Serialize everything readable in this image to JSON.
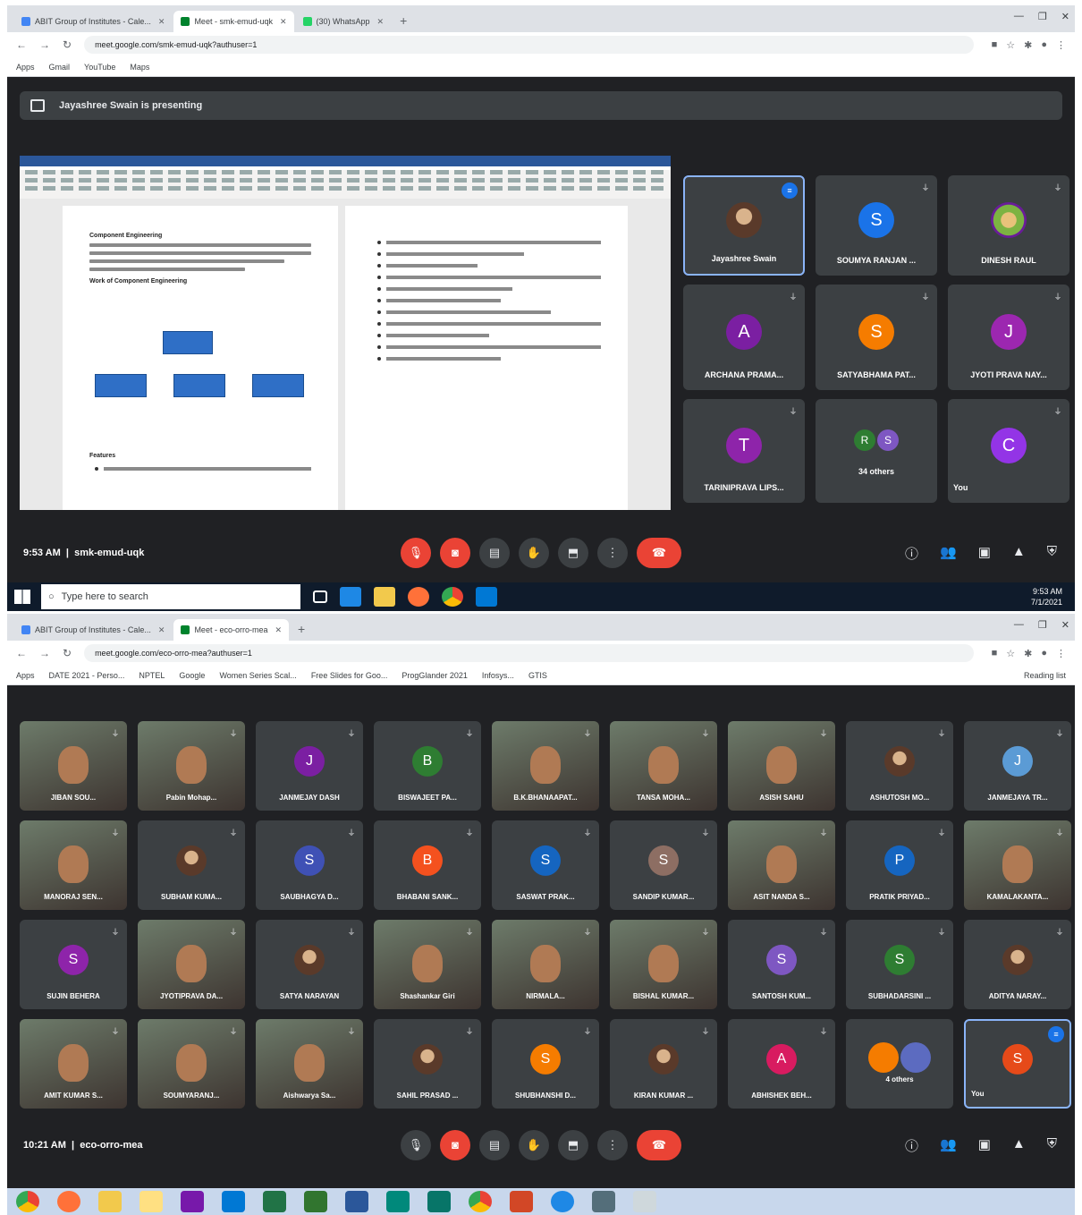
{
  "screen1": {
    "tabs": [
      {
        "label": "ABIT Group of Institutes - Cale...",
        "fav": "#4285f4"
      },
      {
        "label": "Meet - smk-emud-uqk",
        "fav": "#00832d"
      },
      {
        "label": "(30) WhatsApp",
        "fav": "#25d366"
      }
    ],
    "url": "meet.google.com/smk-emud-uqk?authuser=1",
    "bookmarks": [
      "Apps",
      "Gmail",
      "YouTube",
      "Maps"
    ],
    "presenting_text": "Jayashree Swain is presenting",
    "doc": {
      "title": "Component Engineering",
      "subtitle": "Work of Component Engineering",
      "section": "Features"
    },
    "tiles": [
      {
        "name": "Jayashree Swain",
        "initial": "",
        "color": "",
        "photo": true,
        "speaking": true
      },
      {
        "name": "SOUMYA RANJAN ...",
        "initial": "S",
        "color": "#1a73e8"
      },
      {
        "name": "DINESH RAUL",
        "initial": "",
        "color": "",
        "photo": true
      },
      {
        "name": "ARCHANA PRAMA...",
        "initial": "A",
        "color": "#7b1fa2"
      },
      {
        "name": "SATYABHAMA PAT...",
        "initial": "S",
        "color": "#f57c00"
      },
      {
        "name": "JYOTI PRAVA NAY...",
        "initial": "J",
        "color": "#9c27b0"
      },
      {
        "name": "TARINIPRAVA LIPS...",
        "initial": "T",
        "color": "#8e24aa"
      },
      {
        "name": "34 others",
        "initial": "",
        "color": "",
        "others": true
      },
      {
        "name": "You",
        "initial": "C",
        "color": "#9334e6"
      }
    ],
    "time": "9:53 AM",
    "code": "smk-emud-uqk",
    "search_placeholder": "Type here to search",
    "clock_time": "9:53 AM",
    "clock_date": "7/1/2021"
  },
  "screen2": {
    "tabs": [
      {
        "label": "ABIT Group of Institutes - Cale...",
        "fav": "#4285f4"
      },
      {
        "label": "Meet - eco-orro-mea",
        "fav": "#00832d"
      }
    ],
    "url": "meet.google.com/eco-orro-mea?authuser=1",
    "bookmarks": [
      "Apps",
      "DATE 2021 - Perso...",
      "NPTEL",
      "Google",
      "Women Series Scal...",
      "Free Slides for Goo...",
      "ProgGlander 2021",
      "Infosys...",
      "GTIS"
    ],
    "reading_list": "Reading list",
    "tiles": [
      {
        "name": "JIBAN SOU...",
        "photo": true
      },
      {
        "name": "Pabin Mohap...",
        "photo": true
      },
      {
        "name": "JANMEJAY DASH",
        "initial": "J",
        "color": "#7b1fa2"
      },
      {
        "name": "BISWAJEET PA...",
        "initial": "B",
        "color": "#2e7d32"
      },
      {
        "name": "B.K.BHANAAPAT...",
        "photo": true
      },
      {
        "name": "TANSA MOHA...",
        "photo": true
      },
      {
        "name": "ASISH SAHU",
        "photo": true
      },
      {
        "name": "ASHUTOSH MO...",
        "photo": true,
        "small": true
      },
      {
        "name": "JANMEJAYA TR...",
        "initial": "J",
        "color": "#5b9bd5"
      },
      {
        "name": "MANORAJ SEN...",
        "photo": true
      },
      {
        "name": "SUBHAM KUMA...",
        "photo": true,
        "small": true
      },
      {
        "name": "SAUBHAGYA D...",
        "initial": "S",
        "color": "#3f51b5"
      },
      {
        "name": "BHABANI SANK...",
        "initial": "B",
        "color": "#f4511e"
      },
      {
        "name": "SASWAT PRAK...",
        "initial": "S",
        "color": "#1565c0"
      },
      {
        "name": "SANDIP KUMAR...",
        "initial": "S",
        "color": "#8d6e63"
      },
      {
        "name": "ASIT NANDA S...",
        "photo": true
      },
      {
        "name": "PRATIK PRIYAD...",
        "initial": "P",
        "color": "#1565c0"
      },
      {
        "name": "KAMALAKANTA...",
        "photo": true
      },
      {
        "name": "SUJIN BEHERA",
        "initial": "S",
        "color": "#8e24aa"
      },
      {
        "name": "JYOTIPRAVA DA...",
        "photo": true
      },
      {
        "name": "SATYA NARAYAN",
        "photo": true,
        "small": true
      },
      {
        "name": "Shashankar Giri",
        "photo": true
      },
      {
        "name": "NIRMALA...",
        "photo": true
      },
      {
        "name": "BISHAL KUMAR...",
        "photo": true
      },
      {
        "name": "SANTOSH KUM...",
        "initial": "S",
        "color": "#7e57c2"
      },
      {
        "name": "SUBHADARSINI ...",
        "initial": "S",
        "color": "#2e7d32"
      },
      {
        "name": "ADITYA NARAY...",
        "photo": true,
        "small": true
      },
      {
        "name": "AMIT KUMAR S...",
        "photo": true
      },
      {
        "name": "SOUMYARANJ...",
        "photo": true
      },
      {
        "name": "Aishwarya Sa...",
        "photo": true
      },
      {
        "name": "SAHIL PRASAD ...",
        "photo": true,
        "small": true
      },
      {
        "name": "SHUBHANSHI D...",
        "initial": "S",
        "color": "#f57c00"
      },
      {
        "name": "KIRAN KUMAR ...",
        "photo": true,
        "small": true
      },
      {
        "name": "ABHISHEK BEH...",
        "initial": "A",
        "color": "#d81b60"
      },
      {
        "name": "4 others",
        "others": true
      },
      {
        "name": "You",
        "initial": "S",
        "color": "#e64a19",
        "speaking": true
      }
    ],
    "time": "10:21 AM",
    "code": "eco-orro-mea"
  }
}
